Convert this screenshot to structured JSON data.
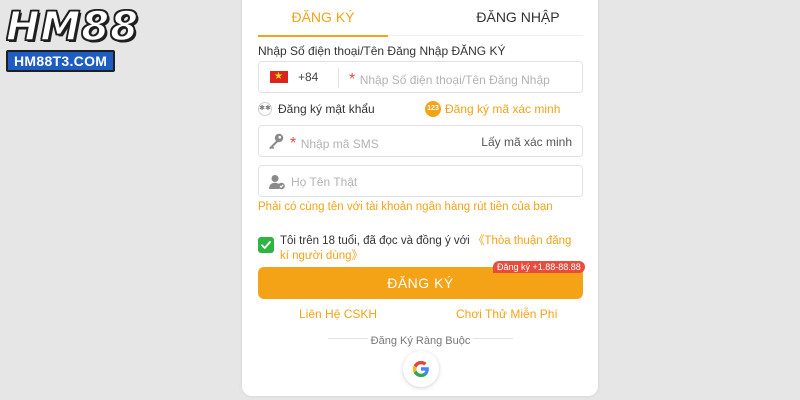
{
  "logo": {
    "big": "HM88",
    "small": "HM88T3.COM"
  },
  "tabs": [
    {
      "label": "ĐĂNG KÝ",
      "active": true
    },
    {
      "label": "ĐĂNG NHẬP",
      "active": false
    }
  ],
  "phone": {
    "label": "Nhập Số điện thoại/Tên Đăng Nhập ĐĂNG KÝ",
    "prefix": "+84",
    "required_mark": "*",
    "placeholder": "Nhập Số điện thoại/Tên Đăng Nhập"
  },
  "mode": {
    "password_option": "Đăng ký mật khẩu",
    "otp_badge": "123",
    "otp_option": "Đăng ký mã xác minh"
  },
  "sms": {
    "required_mark": "*",
    "placeholder": "Nhập mã SMS",
    "get_code": "Lấy mã xác minh"
  },
  "real_name": {
    "placeholder": "Họ Tên Thật",
    "hint": "Phải có cùng tên với tài khoản ngân hàng rút tiền của bạn"
  },
  "agreement": {
    "checked": true,
    "text": "Tôi trên 18 tuổi, đã đọc và đồng ý với ",
    "link": "《Thỏa thuận đăng kí người dùng》"
  },
  "submit": {
    "label": "ĐĂNG KÝ",
    "bonus_badge": "Đăng ký +1.88-88.88"
  },
  "links": {
    "support": "Liên Hệ CSKH",
    "free_trial": "Chơi Thử Miễn Phí"
  },
  "binding": {
    "label": "Đăng Ký Ràng Buộc"
  },
  "colors": {
    "accent": "#f5a316",
    "check": "#2fb444",
    "badge": "#e74c3c",
    "logo_blue": "#1e5dc4"
  },
  "icons": [
    "vietnam-flag-icon",
    "key-icon",
    "user-check-icon",
    "checkmark-icon",
    "google-icon"
  ]
}
